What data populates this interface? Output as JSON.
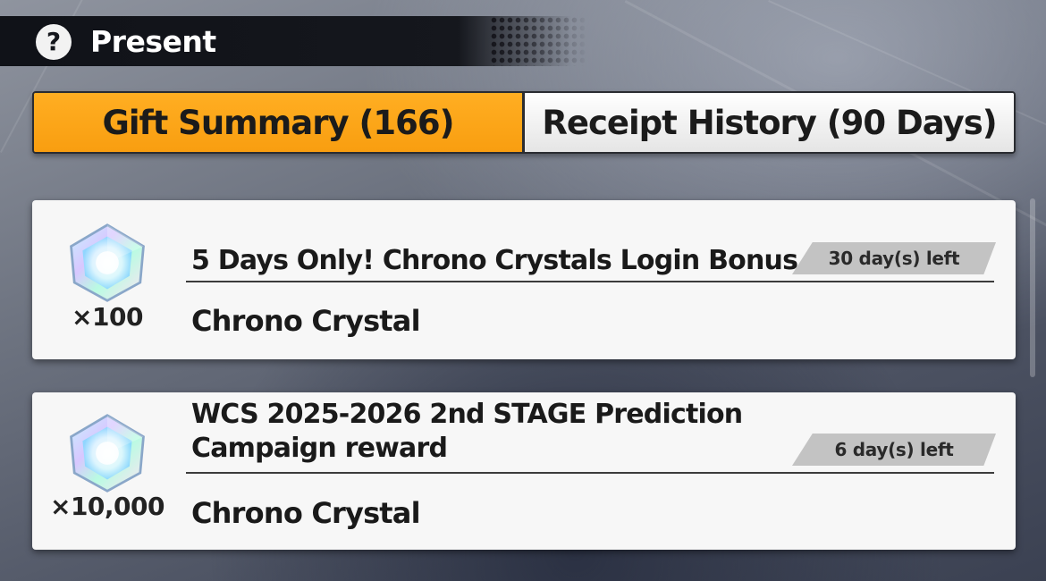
{
  "header": {
    "title": "Present",
    "help_icon": "question-mark-icon"
  },
  "tabs": [
    {
      "label": "Gift Summary (166)",
      "active": true
    },
    {
      "label": "Receipt History (90 Days)",
      "active": false
    }
  ],
  "gifts": [
    {
      "icon": "chrono-crystal-icon",
      "quantity": "×100",
      "title_lines": [
        "5 Days Only! Chrono Crystals Login Bonus"
      ],
      "item": "Chrono Crystal",
      "expiry": "30 day(s) left"
    },
    {
      "icon": "chrono-crystal-icon",
      "quantity": "×10,000",
      "title_lines": [
        "WCS 2025-2026 2nd STAGE Prediction",
        "Campaign reward"
      ],
      "item": "Chrono Crystal",
      "expiry": "6 day(s) left"
    }
  ],
  "colors": {
    "active_tab": "#f9a61a",
    "header_bar": "#15171d",
    "card_bg": "#f7f7f7",
    "expiry_badge": "#c3c3c3"
  }
}
